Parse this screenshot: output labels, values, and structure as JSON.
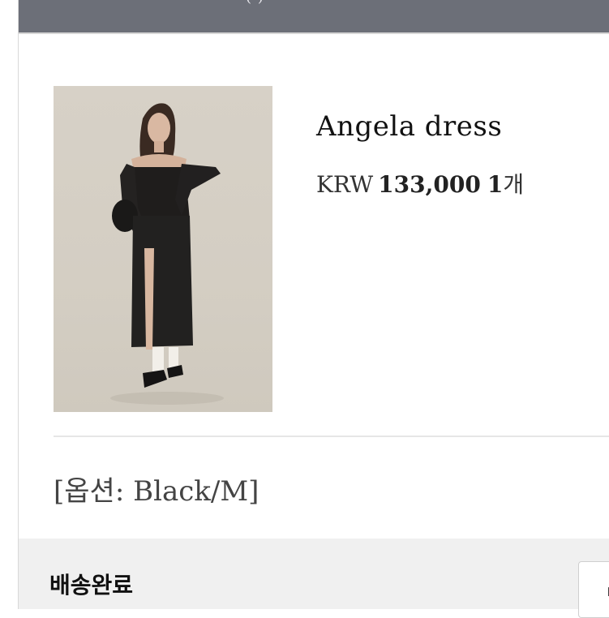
{
  "header": {
    "partial_text": "(                    )"
  },
  "product": {
    "name": "Angela dress",
    "image_alt": "Angela dress photo",
    "currency": "KRW",
    "price": "133,000",
    "quantity": "1",
    "quantity_unit": "개"
  },
  "option": {
    "text": "[옵션: Black/M]"
  },
  "status": {
    "label": "배송완료",
    "button_partial": "ㅂ"
  },
  "colors": {
    "top_bar": "#6c6f78",
    "status_bar": "#f0f0f0",
    "divider": "#e6e6e6"
  }
}
